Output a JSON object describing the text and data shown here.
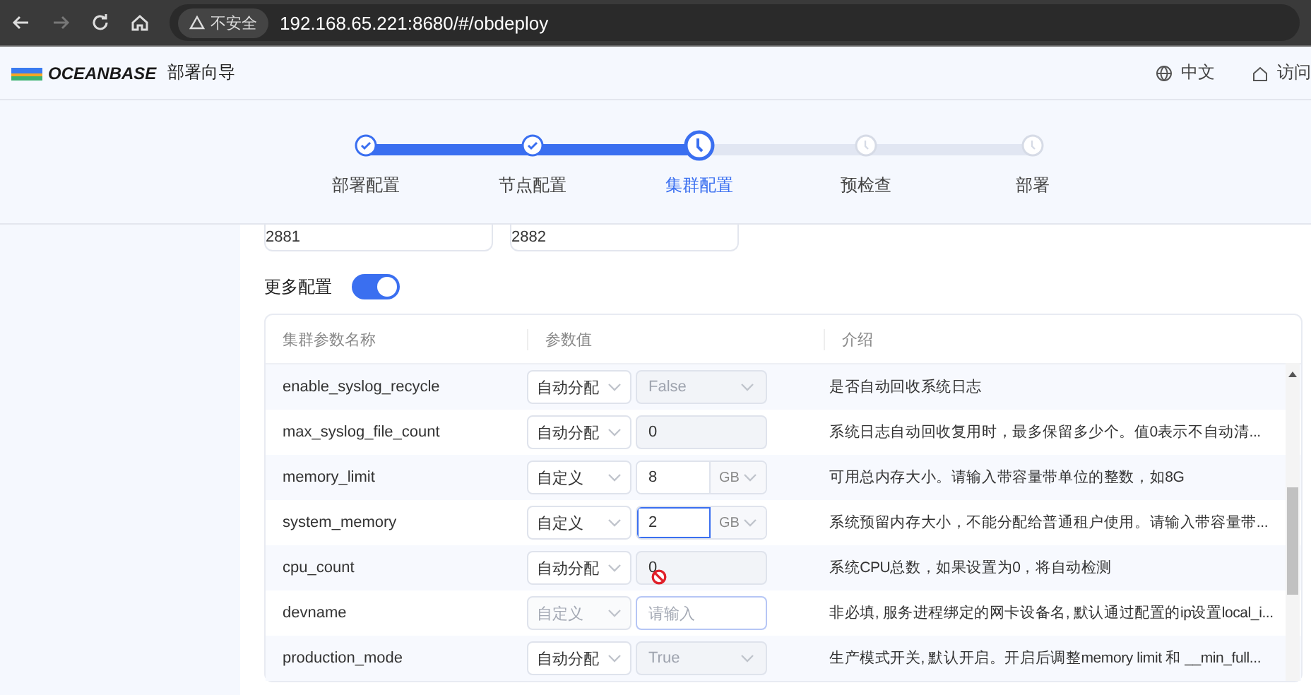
{
  "browser": {
    "security": "不安全",
    "url": "192.168.65.221:8680/#/obdeploy"
  },
  "header": {
    "logo": "OCEANBASE",
    "title": "部署向导",
    "language": "中文",
    "visit": "访问"
  },
  "steps": [
    {
      "label": "部署配置",
      "completed": true,
      "selected": false
    },
    {
      "label": "节点配置",
      "completed": true,
      "selected": false
    },
    {
      "label": "集群配置",
      "completed": false,
      "selected": true
    },
    {
      "label": "预检查",
      "completed": false,
      "selected": false
    },
    {
      "label": "部署",
      "completed": false,
      "selected": false
    }
  ],
  "ports": [
    "2881",
    "2882"
  ],
  "more_config": {
    "label": "更多配置",
    "on": true
  },
  "table": {
    "columns": [
      "集群参数名称",
      "参数值",
      "介绍"
    ],
    "rows": [
      {
        "name": "enable_syslog_recycle",
        "mode": {
          "text": "自动分配",
          "disabled": false
        },
        "value": {
          "kind": "select",
          "text": "False"
        },
        "intro": "是否自动回收系统日志"
      },
      {
        "name": "max_syslog_file_count",
        "mode": {
          "text": "自动分配",
          "disabled": false
        },
        "value": {
          "kind": "input",
          "text": "0",
          "editable": false
        },
        "intro": "系统日志自动回收复用时，最多保留多少个。值0表示不自动清..."
      },
      {
        "name": "memory_limit",
        "mode": {
          "text": "自定义",
          "disabled": false
        },
        "value": {
          "kind": "size",
          "text": "8",
          "unit": "GB",
          "focused": false
        },
        "intro": "可用总内存大小。请输入带容量带单位的整数，如8G"
      },
      {
        "name": "system_memory",
        "mode": {
          "text": "自定义",
          "disabled": false
        },
        "value": {
          "kind": "size",
          "text": "2",
          "unit": "GB",
          "focused": true
        },
        "intro": "系统预留内存大小，不能分配给普通租户使用。请输入带容量带..."
      },
      {
        "name": "cpu_count",
        "mode": {
          "text": "自动分配",
          "disabled": false
        },
        "value": {
          "kind": "input",
          "text": "0",
          "editable": false,
          "blocked_cursor": true
        },
        "intro": "系统CPU总数，如果设置为0，将自动检测"
      },
      {
        "name": "devname",
        "mode": {
          "text": "自定义",
          "disabled": true
        },
        "value": {
          "kind": "input",
          "placeholder": "请输入",
          "editable": true
        },
        "intro": "非必填, 服务进程绑定的网卡设备名, 默认通过配置的ip设置local_i..."
      },
      {
        "name": "production_mode",
        "mode": {
          "text": "自动分配",
          "disabled": false
        },
        "value": {
          "kind": "select",
          "text": "True"
        },
        "intro": "生产模式开关, 默认开启。开启后调整memory limit 和 __min_full..."
      }
    ]
  }
}
